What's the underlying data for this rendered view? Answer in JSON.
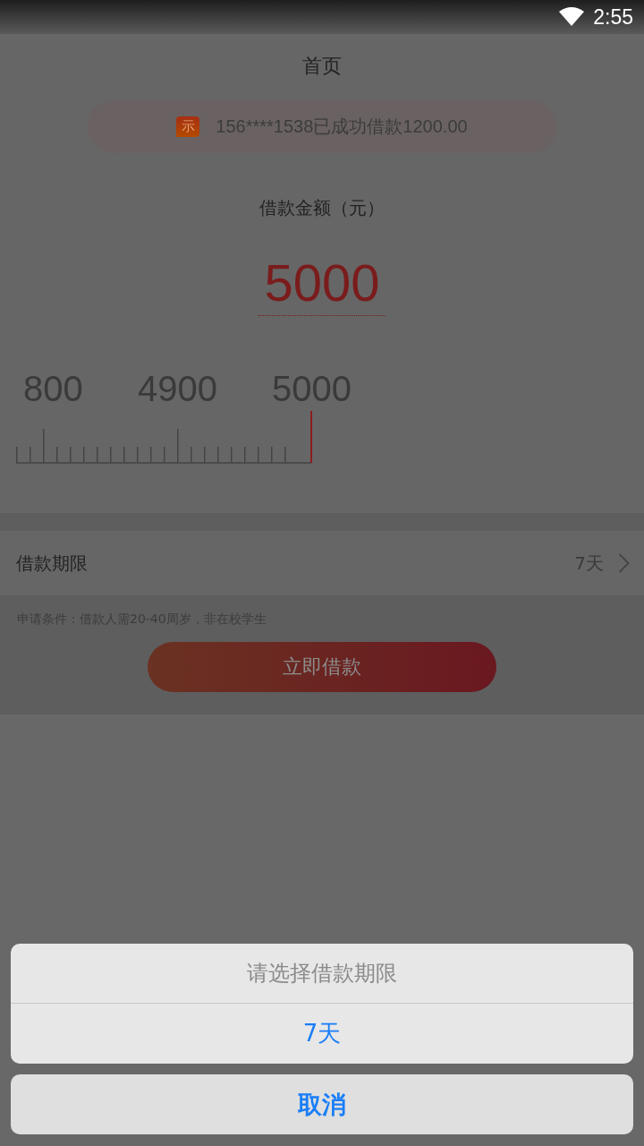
{
  "status_bar": {
    "time": "2:55"
  },
  "header": {
    "title": "首页"
  },
  "notice": {
    "text": "156****1538已成功借款1200.00",
    "icon_text": "示"
  },
  "amount": {
    "label": "借款金额（元）",
    "value": "5000"
  },
  "ruler": {
    "labels": [
      "800",
      "4900",
      "5000"
    ]
  },
  "term": {
    "label": "借款期限",
    "value": "7天"
  },
  "condition": "申请条件：借款人需20-40周岁，非在校学生",
  "apply_button": "立即借款",
  "action_sheet": {
    "title": "请选择借款期限",
    "options": [
      "7天"
    ],
    "cancel": "取消"
  }
}
